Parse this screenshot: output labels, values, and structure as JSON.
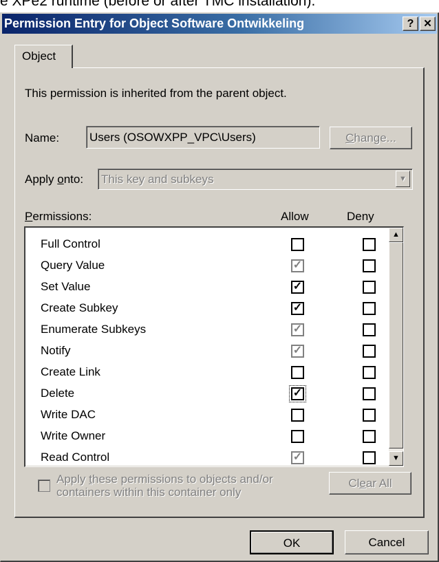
{
  "background_text": "e XPe2 runtime (before or after TMC installation).",
  "titlebar": {
    "title": "Permission Entry for Object Software Ontwikkeling",
    "help_label": "?",
    "close_label": "✕"
  },
  "tabs": [
    {
      "label": "Object"
    }
  ],
  "info_text": "This permission is inherited from the parent object.",
  "name": {
    "label_pre": "Name:",
    "value": "Users (OSOWXPP_VPC\\Users)",
    "change_btn_first": "C",
    "change_btn_rest": "hange..."
  },
  "apply_onto": {
    "label_pre": "Apply ",
    "label_u": "o",
    "label_post": "nto:",
    "value": "This key and subkeys",
    "arrow": "▼"
  },
  "permissions": {
    "header_u": "P",
    "header_rest": "ermissions:",
    "allow_label": "Allow",
    "deny_label": "Deny",
    "rows": [
      {
        "label": "Full Control",
        "allow": "unchecked",
        "deny": "unchecked"
      },
      {
        "label": "Query Value",
        "allow": "inherited",
        "deny": "unchecked"
      },
      {
        "label": "Set Value",
        "allow": "checked",
        "deny": "unchecked"
      },
      {
        "label": "Create Subkey",
        "allow": "checked",
        "deny": "unchecked"
      },
      {
        "label": "Enumerate Subkeys",
        "allow": "inherited",
        "deny": "unchecked"
      },
      {
        "label": "Notify",
        "allow": "inherited",
        "deny": "unchecked"
      },
      {
        "label": "Create Link",
        "allow": "unchecked",
        "deny": "unchecked"
      },
      {
        "label": "Delete",
        "allow": "checked-focus",
        "deny": "unchecked"
      },
      {
        "label": "Write DAC",
        "allow": "unchecked",
        "deny": "unchecked"
      },
      {
        "label": "Write Owner",
        "allow": "unchecked",
        "deny": "unchecked"
      },
      {
        "label": "Read Control",
        "allow": "inherited",
        "deny": "unchecked"
      }
    ]
  },
  "apply_checkbox": {
    "line1_pre": "Apply ",
    "line1_u": "t",
    "line1_post": "hese permissions to objects and/or",
    "line2": "containers within this container only"
  },
  "clear_all": {
    "pre": "Cl",
    "u": "e",
    "post": "ar All"
  },
  "footer": {
    "ok_label": "OK",
    "cancel_label": "Cancel"
  },
  "colors": {
    "title_start": "#0a246a",
    "title_end": "#a6caf0",
    "face": "#d4d0c8"
  }
}
